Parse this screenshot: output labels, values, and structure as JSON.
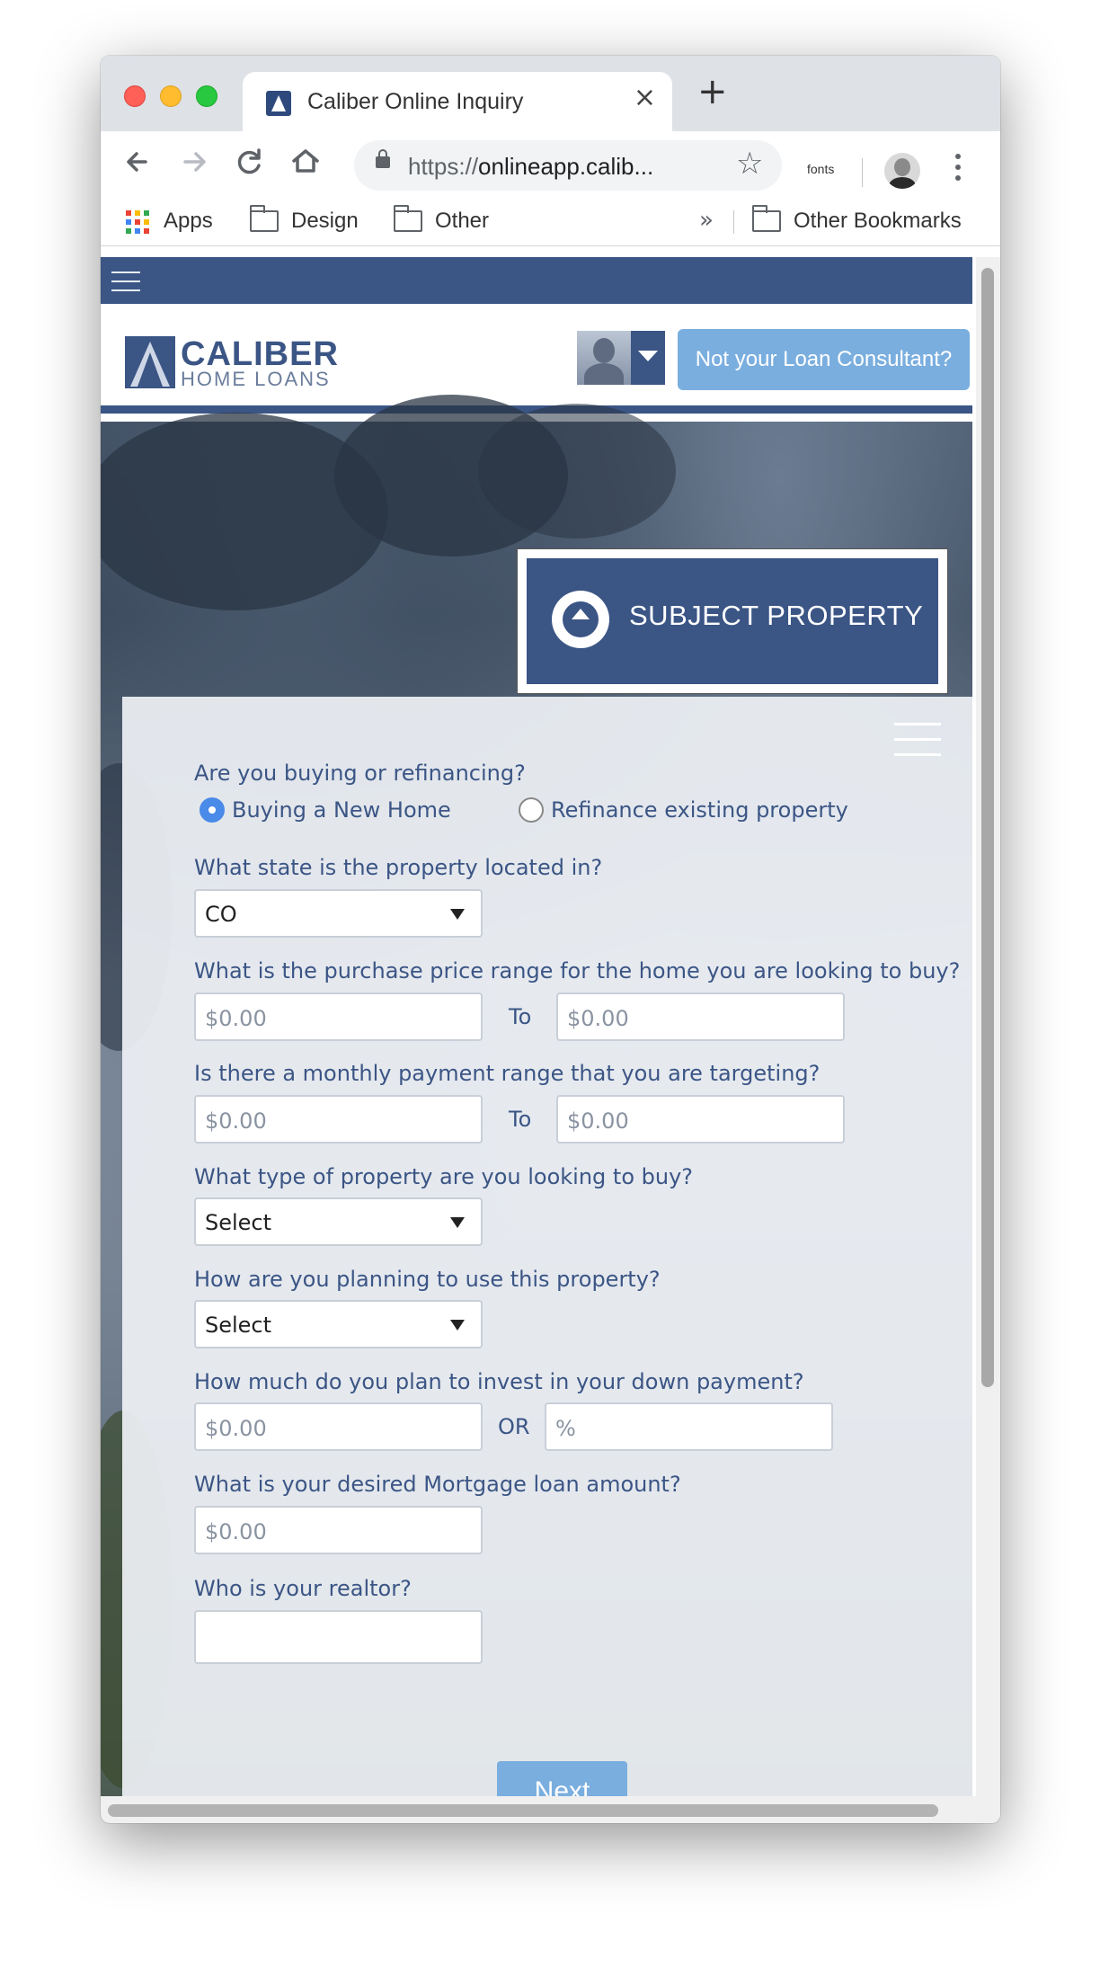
{
  "browser": {
    "tab_title": "Caliber Online Inquiry",
    "tab_close": "×",
    "new_tab": "+",
    "url_scheme": "https://",
    "url_host": "onlineapp.calib...",
    "extension_label": "fonts",
    "bookmarks": [
      {
        "label": "Apps",
        "icon": "apps-grid-icon"
      },
      {
        "label": "Design",
        "icon": "folder-icon"
      },
      {
        "label": "Other",
        "icon": "folder-icon"
      }
    ],
    "more_bookmarks": "»",
    "other_bookmarks": "Other Bookmarks"
  },
  "site": {
    "logo_name": "CALIBER",
    "logo_sub": "HOME LOANS",
    "consultant_button": "Not your Loan Consultant?",
    "section_title": "SUBJECT PROPERTY",
    "colors": {
      "brand": "#3b5585",
      "accent": "#7aaedf",
      "radio_selected": "#4a8ae8"
    }
  },
  "form": {
    "q_buying": "Are you buying or refinancing?",
    "radio_options": [
      {
        "label": "Buying a New Home",
        "checked": true
      },
      {
        "label": "Refinance existing property",
        "checked": false
      }
    ],
    "q_state": "What state is the property located in?",
    "state_value": "CO",
    "q_purchase_price": "What is the purchase price range for the home you are looking to buy?",
    "price_from_placeholder": "$0.00",
    "price_to_placeholder": "$0.00",
    "range_to": "To",
    "q_monthly": "Is there a monthly payment range that you are targeting?",
    "monthly_from_placeholder": "$0.00",
    "monthly_to_placeholder": "$0.00",
    "q_property_type": "What type of property are you looking to buy?",
    "property_type_value": "Select",
    "q_usage": "How are you planning to use this property?",
    "usage_value": "Select",
    "q_down_payment": "How much do you plan to invest in your down payment?",
    "down_amount_placeholder": "$0.00",
    "down_or": "OR",
    "down_percent_placeholder": "%",
    "q_loan_amount": "What is your desired Mortgage loan amount?",
    "loan_amount_placeholder": "$0.00",
    "q_realtor": "Who is your realtor?",
    "realtor_value": "",
    "next_label": "Next"
  }
}
